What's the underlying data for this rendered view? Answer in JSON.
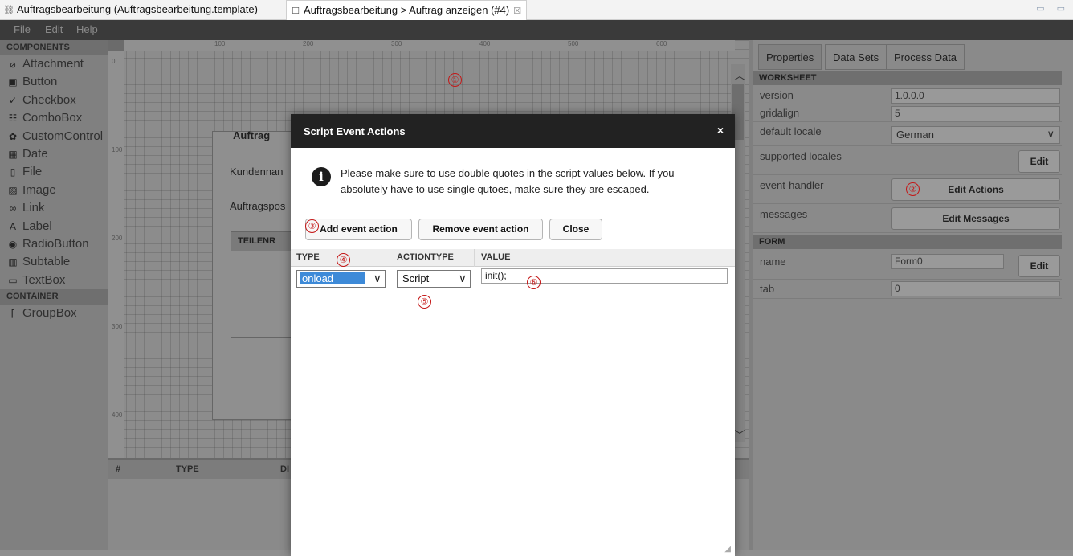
{
  "tabs": {
    "editor_title": "Auftragsbearbeitung (Auftragsbearbeitung.template)",
    "form_title": "Auftragsbearbeitung > Auftrag anzeigen (#4)",
    "close_glyph": "☒",
    "window_controls": "▭ ▭"
  },
  "menu": {
    "file": "File",
    "edit": "Edit",
    "help": "Help"
  },
  "components": {
    "heading": "COMPONENTS",
    "items": [
      "Attachment",
      "Button",
      "Checkbox",
      "ComboBox",
      "CustomControl",
      "Date",
      "File",
      "Image",
      "Link",
      "Label",
      "RadioButton",
      "Subtable",
      "TextBox"
    ],
    "container_heading": "CONTAINER",
    "container_items": [
      "GroupBox"
    ]
  },
  "ruler": {
    "h_marks": [
      "100",
      "200",
      "300",
      "400",
      "500",
      "600"
    ],
    "v_marks": [
      "0",
      "100",
      "200",
      "300",
      "400"
    ]
  },
  "form": {
    "group_title": "Auftrag",
    "customer_label": "Kundennan",
    "positions_label": "Auftragspos",
    "table_header": "TEILENR"
  },
  "bottom_grid": {
    "col_num": "#",
    "col_type": "TYPE",
    "col_d": "DI"
  },
  "properties": {
    "tabs": [
      "Properties",
      "Data Sets",
      "Process Data"
    ],
    "worksheet_heading": "WORKSHEET",
    "version_key": "version",
    "version_val": "1.0.0.0",
    "gridalign_key": "gridalign",
    "gridalign_val": "5",
    "locale_key": "default locale",
    "locale_val": "German",
    "supported_key": "supported locales",
    "supported_btn": "Edit",
    "event_key": "event-handler",
    "event_btn": "Edit Actions",
    "messages_key": "messages",
    "messages_btn": "Edit Messages",
    "form_heading": "FORM",
    "name_key": "name",
    "name_val": "Form0",
    "name_btn": "Edit",
    "tab_key": "tab",
    "tab_val": "0"
  },
  "dialog": {
    "title": "Script Event Actions",
    "close": "×",
    "info": "Please make sure to use double quotes in the script values below. If you absolutely have to use single qutoes, make sure they are escaped.",
    "add_btn": "Add event action",
    "remove_btn": "Remove event action",
    "close_btn": "Close",
    "col_type": "TYPE",
    "col_actiontype": "ACTIONTYPE",
    "col_value": "VALUE",
    "row": {
      "type": "onload",
      "actiontype": "Script",
      "value": "init();"
    }
  },
  "markers": [
    "①",
    "②",
    "③",
    "④",
    "⑤",
    "⑥"
  ],
  "colors": {
    "dialog_title_bg": "#222222",
    "selection_blue": "#3d8ad8",
    "marker_red": "#c41717"
  }
}
